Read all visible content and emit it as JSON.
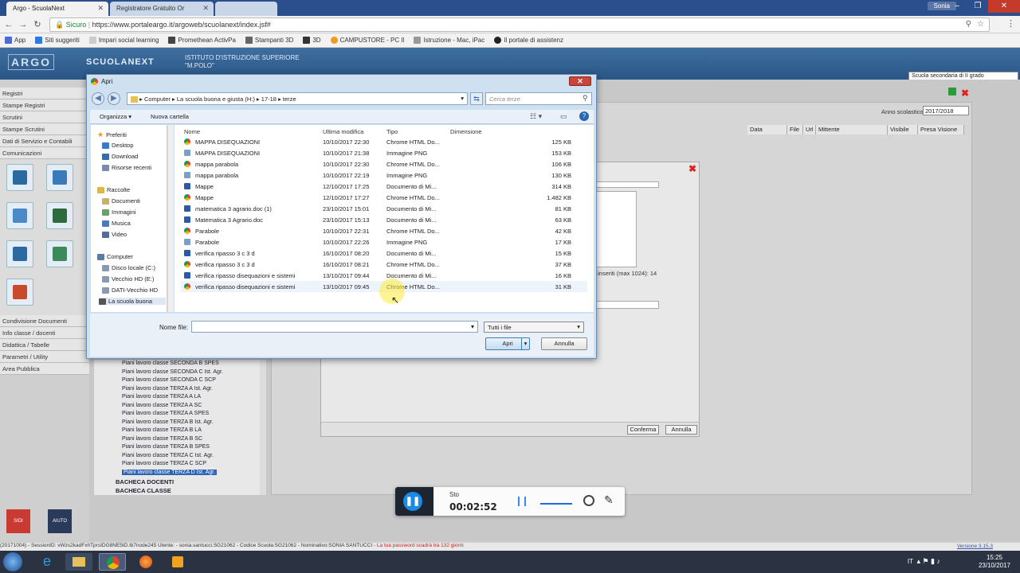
{
  "browser": {
    "tabs": [
      {
        "label": "Argo - ScuolaNext",
        "active": true
      },
      {
        "label": "Registratore Gratuito Or",
        "active": false
      },
      {
        "label": "",
        "active": false
      }
    ],
    "profile": "Sonia",
    "secure_label": "Sicuro",
    "url": "https://www.portaleargo.it/argoweb/scuolanext/index.jsf#",
    "bookmarks": [
      "App",
      "Siti suggeriti",
      "Impari social learning",
      "Promethean ActivPa",
      "Stampanti 3D",
      "3D",
      "CAMPUSTORE - PC Il",
      "Istruzione - Mac, iPac",
      "Il portale di assistenz"
    ],
    "colors": {
      "tabstrip": "#2a4f8c",
      "secure": "#0a8a2a"
    }
  },
  "argo": {
    "logo": "ARGO",
    "brand": "SCUOLANEXT",
    "school_line1": "ISTITUTO D'ISTRUZIONE SUPERIORE",
    "school_line2": "\"M.POLO\"",
    "school_select": "Scuola secondaria di II grado",
    "year_label": "Anno scolastico:",
    "year_value": "2017/2018",
    "grid_headers": [
      "Data",
      "File",
      "Url",
      "Mittente",
      "Visibile",
      "Presa Visione"
    ],
    "inserted_text": "inseriti (max 1024): 14",
    "confirm_label": "Conferma",
    "cancel_label": "Annulla"
  },
  "left_menu": {
    "items_top": [
      "Registri",
      "Stampe Registri",
      "Scrutini",
      "Stampe Scrutini",
      "Dati di Servizio e Contabili",
      "Comunicazioni"
    ],
    "items_bottom": [
      "Condivisione Documenti",
      "Info classe / docenti",
      "Didattica / Tabelle",
      "Parametri / Utility",
      "Area Pubblica"
    ],
    "bottom_icons": [
      "SIDI",
      "AIUTO"
    ]
  },
  "tree": {
    "items": [
      "Piani lavoro classe SECONDA B SPES",
      "Piani lavoro classe SECONDA C Ist. Agr.",
      "Piani lavoro classe SECONDA C SCP",
      "Piani lavoro classe TERZA A Ist. Agr.",
      "Piani lavoro classe TERZA A LA",
      "Piani lavoro classe TERZA A SC",
      "Piani lavoro classe TERZA A SPES",
      "Piani lavoro classe TERZA B Ist. Agr.",
      "Piani lavoro classe TERZA B LA",
      "Piani lavoro classe TERZA B SC",
      "Piani lavoro classe TERZA B SPES",
      "Piani lavoro classe TERZA C Ist. Agr.",
      "Piani lavoro classe TERZA C SCP",
      "Piani lavoro classe TERZA D Ist. Agr."
    ],
    "roots": [
      "BACHECA DOCENTI",
      "BACHECA CLASSE"
    ]
  },
  "dialog": {
    "title": "Apri",
    "path": [
      "Computer",
      "La scuola  buona e giusta (H:)",
      "17-18",
      "terze"
    ],
    "search_placeholder": "Cerca terze",
    "organize_label": "Organizza",
    "new_folder_label": "Nuova cartella",
    "nav": {
      "favorites_header": "Preferiti",
      "favorites": [
        "Desktop",
        "Download",
        "Risorse recenti"
      ],
      "libraries_header": "Raccolte",
      "libraries": [
        "Documenti",
        "Immagini",
        "Musica",
        "Video"
      ],
      "computer_header": "Computer",
      "drives": [
        "Disco locale (C:)",
        "Vecchio HD (E:)",
        "DATI-Vecchio HD",
        "La scuola  buona"
      ]
    },
    "columns": {
      "name": "Nome",
      "modified": "Ultima modifica",
      "type": "Tipo",
      "size": "Dimensione"
    },
    "files": [
      {
        "name": "MAPPA DISEQUAZIONI",
        "modified": "10/10/2017 22:30",
        "type": "Chrome HTML Do...",
        "size": "125 KB",
        "icon": "chr"
      },
      {
        "name": "MAPPA DISEQUAZIONI",
        "modified": "10/10/2017 21:38",
        "type": "Immagine PNG",
        "size": "153 KB",
        "icon": "img"
      },
      {
        "name": "mappa parabola",
        "modified": "10/10/2017 22:30",
        "type": "Chrome HTML Do...",
        "size": "106 KB",
        "icon": "chr"
      },
      {
        "name": "mappa parabola",
        "modified": "10/10/2017 22:19",
        "type": "Immagine PNG",
        "size": "130 KB",
        "icon": "img"
      },
      {
        "name": "Mappe",
        "modified": "12/10/2017 17:25",
        "type": "Documento di Mi...",
        "size": "314 KB",
        "icon": "doc"
      },
      {
        "name": "Mappe",
        "modified": "12/10/2017 17:27",
        "type": "Chrome HTML Do...",
        "size": "1.482 KB",
        "icon": "chr"
      },
      {
        "name": "matematica 3 agrario.doc (1)",
        "modified": "23/10/2017 15:01",
        "type": "Documento di Mi...",
        "size": "81 KB",
        "icon": "doc"
      },
      {
        "name": "Matematica 3 Agrario.doc",
        "modified": "23/10/2017 15:13",
        "type": "Documento di Mi...",
        "size": "63 KB",
        "icon": "doc"
      },
      {
        "name": "Parabole",
        "modified": "10/10/2017 22:31",
        "type": "Chrome HTML Do...",
        "size": "42 KB",
        "icon": "chr"
      },
      {
        "name": "Parabole",
        "modified": "10/10/2017 22:26",
        "type": "Immagine PNG",
        "size": "17 KB",
        "icon": "img"
      },
      {
        "name": "verifica ripasso 3 c 3 d",
        "modified": "16/10/2017 08:20",
        "type": "Documento di Mi...",
        "size": "15 KB",
        "icon": "doc"
      },
      {
        "name": "verifica ripasso 3 c 3 d",
        "modified": "16/10/2017 08:21",
        "type": "Chrome HTML Do...",
        "size": "37 KB",
        "icon": "chr"
      },
      {
        "name": "verifica ripasso disequazioni e sistemi",
        "modified": "13/10/2017 09:44",
        "type": "Documento di Mi...",
        "size": "16 KB",
        "icon": "doc"
      },
      {
        "name": "verifica ripasso disequazioni e sistemi",
        "modified": "13/10/2017 09:45",
        "type": "Chrome HTML Do...",
        "size": "31 KB",
        "icon": "chr"
      }
    ],
    "filename_label": "Nome file:",
    "filename_value": "",
    "filetype": "Tutti i file",
    "open_label": "Apri",
    "cancel_label": "Annulla"
  },
  "recorder": {
    "state": "Sto",
    "time": "00:02:52"
  },
  "status": {
    "session": "(20171004) - SessionID: vWzs2kadFxhTprsIDG8NE5tD.lb7node245 Utente: - sonia.santucci.SG21062 - Codice Scuola:SG21062 - Nominativo:SONIA SANTUCCI",
    "warning": "- La tua password scadrà tra 132 giorni",
    "version": "Versione 3.15.3"
  },
  "taskbar": {
    "lang": "IT",
    "time": "15:25",
    "date": "23/10/2017"
  }
}
